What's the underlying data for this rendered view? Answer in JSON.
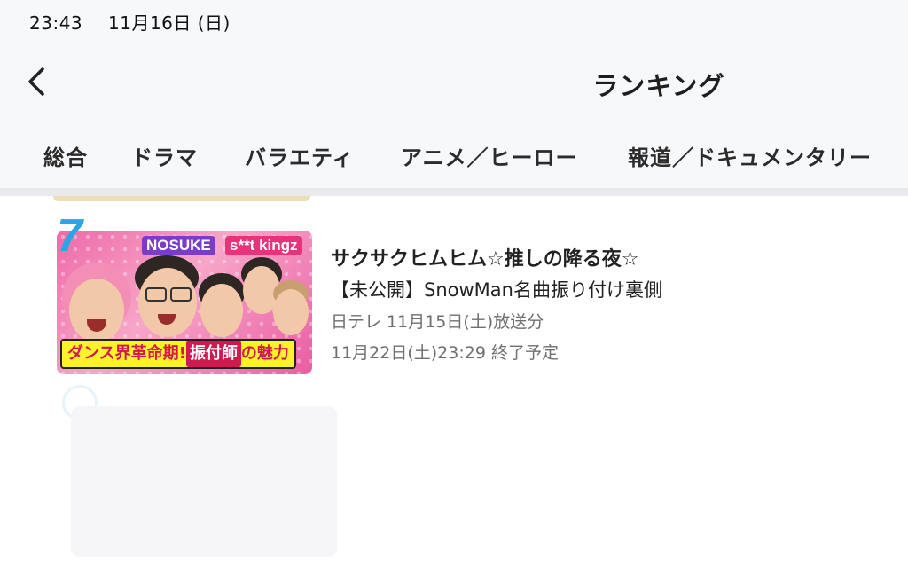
{
  "status_bar": {
    "time": "23:43",
    "date": "11月16日 (日)"
  },
  "nav": {
    "title": "ランキング",
    "back_icon": "chevron-left-icon"
  },
  "tabs": [
    {
      "label": "総合"
    },
    {
      "label": "ドラマ"
    },
    {
      "label": "バラエティ",
      "selected": true
    },
    {
      "label": "アニメ／ヒーロー"
    },
    {
      "label": "報道／ドキュメンタリー"
    }
  ],
  "accent_color": "#22a8e6",
  "ranking_item": {
    "rank": "7",
    "thumbnail": {
      "label_left": "NOSUKE",
      "label_right": "s**t kingz",
      "caption_prefix": "ダンス界革命期!",
      "caption_highlight": "振付師",
      "caption_suffix": "の魅力"
    },
    "title": "サクサクヒムヒム☆推しの降る夜☆",
    "subtitle": "【未公開】SnowMan名曲振り付け裏側",
    "broadcast_info": "日テレ 11月15日(土)放送分",
    "end_info": "11月22日(土)23:29 終了予定"
  }
}
